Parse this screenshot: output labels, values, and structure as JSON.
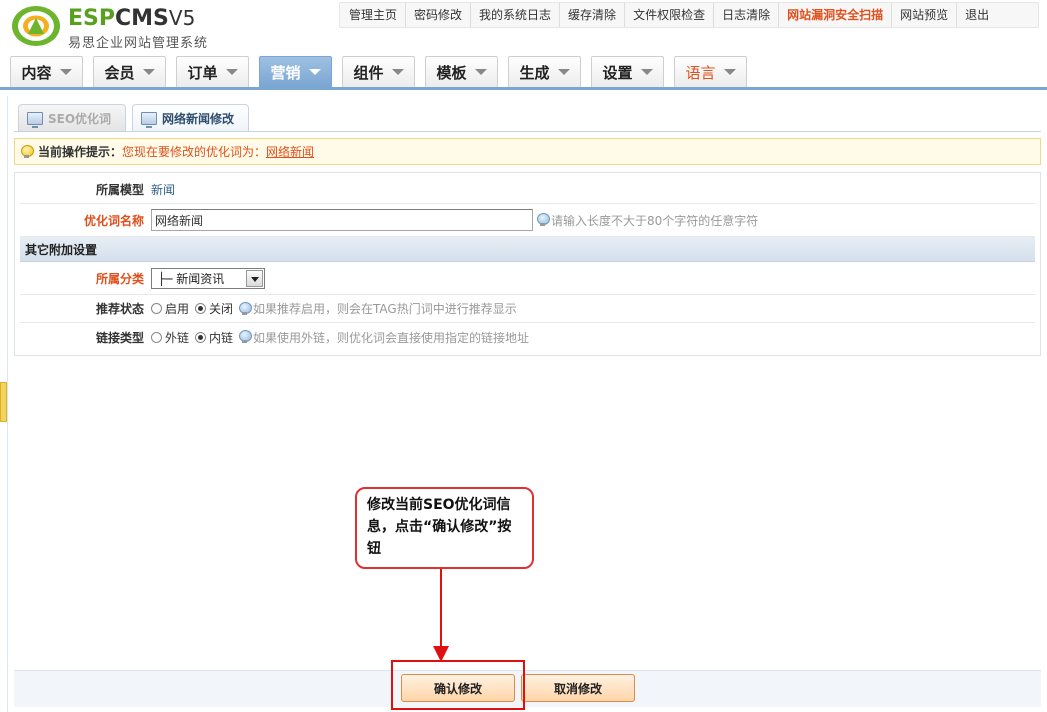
{
  "brand": {
    "logo_esp": "ESP",
    "logo_cms": "CMS",
    "logo_version": "V5",
    "subtitle": "易思企业网站管理系统"
  },
  "topbar": [
    {
      "label": "管理主页",
      "warn": false
    },
    {
      "label": "密码修改",
      "warn": false
    },
    {
      "label": "我的系统日志",
      "warn": false
    },
    {
      "label": "缓存清除",
      "warn": false
    },
    {
      "label": "文件权限检查",
      "warn": false
    },
    {
      "label": "日志清除",
      "warn": false
    },
    {
      "label": "网站漏洞安全扫描",
      "warn": true
    },
    {
      "label": "网站预览",
      "warn": false
    },
    {
      "label": "退出",
      "warn": false
    }
  ],
  "nav": [
    {
      "label": "内容",
      "active": false
    },
    {
      "label": "会员",
      "active": false
    },
    {
      "label": "订单",
      "active": false
    },
    {
      "label": "营销",
      "active": true
    },
    {
      "label": "组件",
      "active": false
    },
    {
      "label": "模板",
      "active": false
    },
    {
      "label": "生成",
      "active": false
    },
    {
      "label": "设置",
      "active": false
    },
    {
      "label": "语言",
      "active": false
    }
  ],
  "tabs": [
    {
      "label": "SEO优化词",
      "active": false
    },
    {
      "label": "网络新闻修改",
      "active": true
    }
  ],
  "tip": {
    "label": "当前操作提示：",
    "text": "您现在要修改的优化词为：",
    "link": "网络新闻"
  },
  "form": {
    "model_label": "所属模型",
    "model_value": "新闻",
    "keyword_label": "优化词名称",
    "keyword_value": "网络新闻",
    "keyword_hint": "请输入长度不大于80个字符的任意字符",
    "section_title": "其它附加设置",
    "category_label": "所属分类",
    "category_value": "├─ 新闻资讯",
    "recommend_label": "推荐状态",
    "recommend_on": "启用",
    "recommend_off": "关闭",
    "recommend_hint": "如果推荐启用，则会在TAG热门词中进行推荐显示",
    "link_label": "链接类型",
    "link_external": "外链",
    "link_internal": "内链",
    "link_hint": "如果使用外链，则优化词会直接使用指定的链接地址"
  },
  "callout": {
    "text": "修改当前SEO优化词信息，点击“确认修改”按钮"
  },
  "buttons": {
    "confirm": "确认修改",
    "cancel": "取消修改"
  },
  "colors": {
    "accent": "#7aa6d2",
    "warn": "#e0501c",
    "annotation": "#e01010"
  }
}
